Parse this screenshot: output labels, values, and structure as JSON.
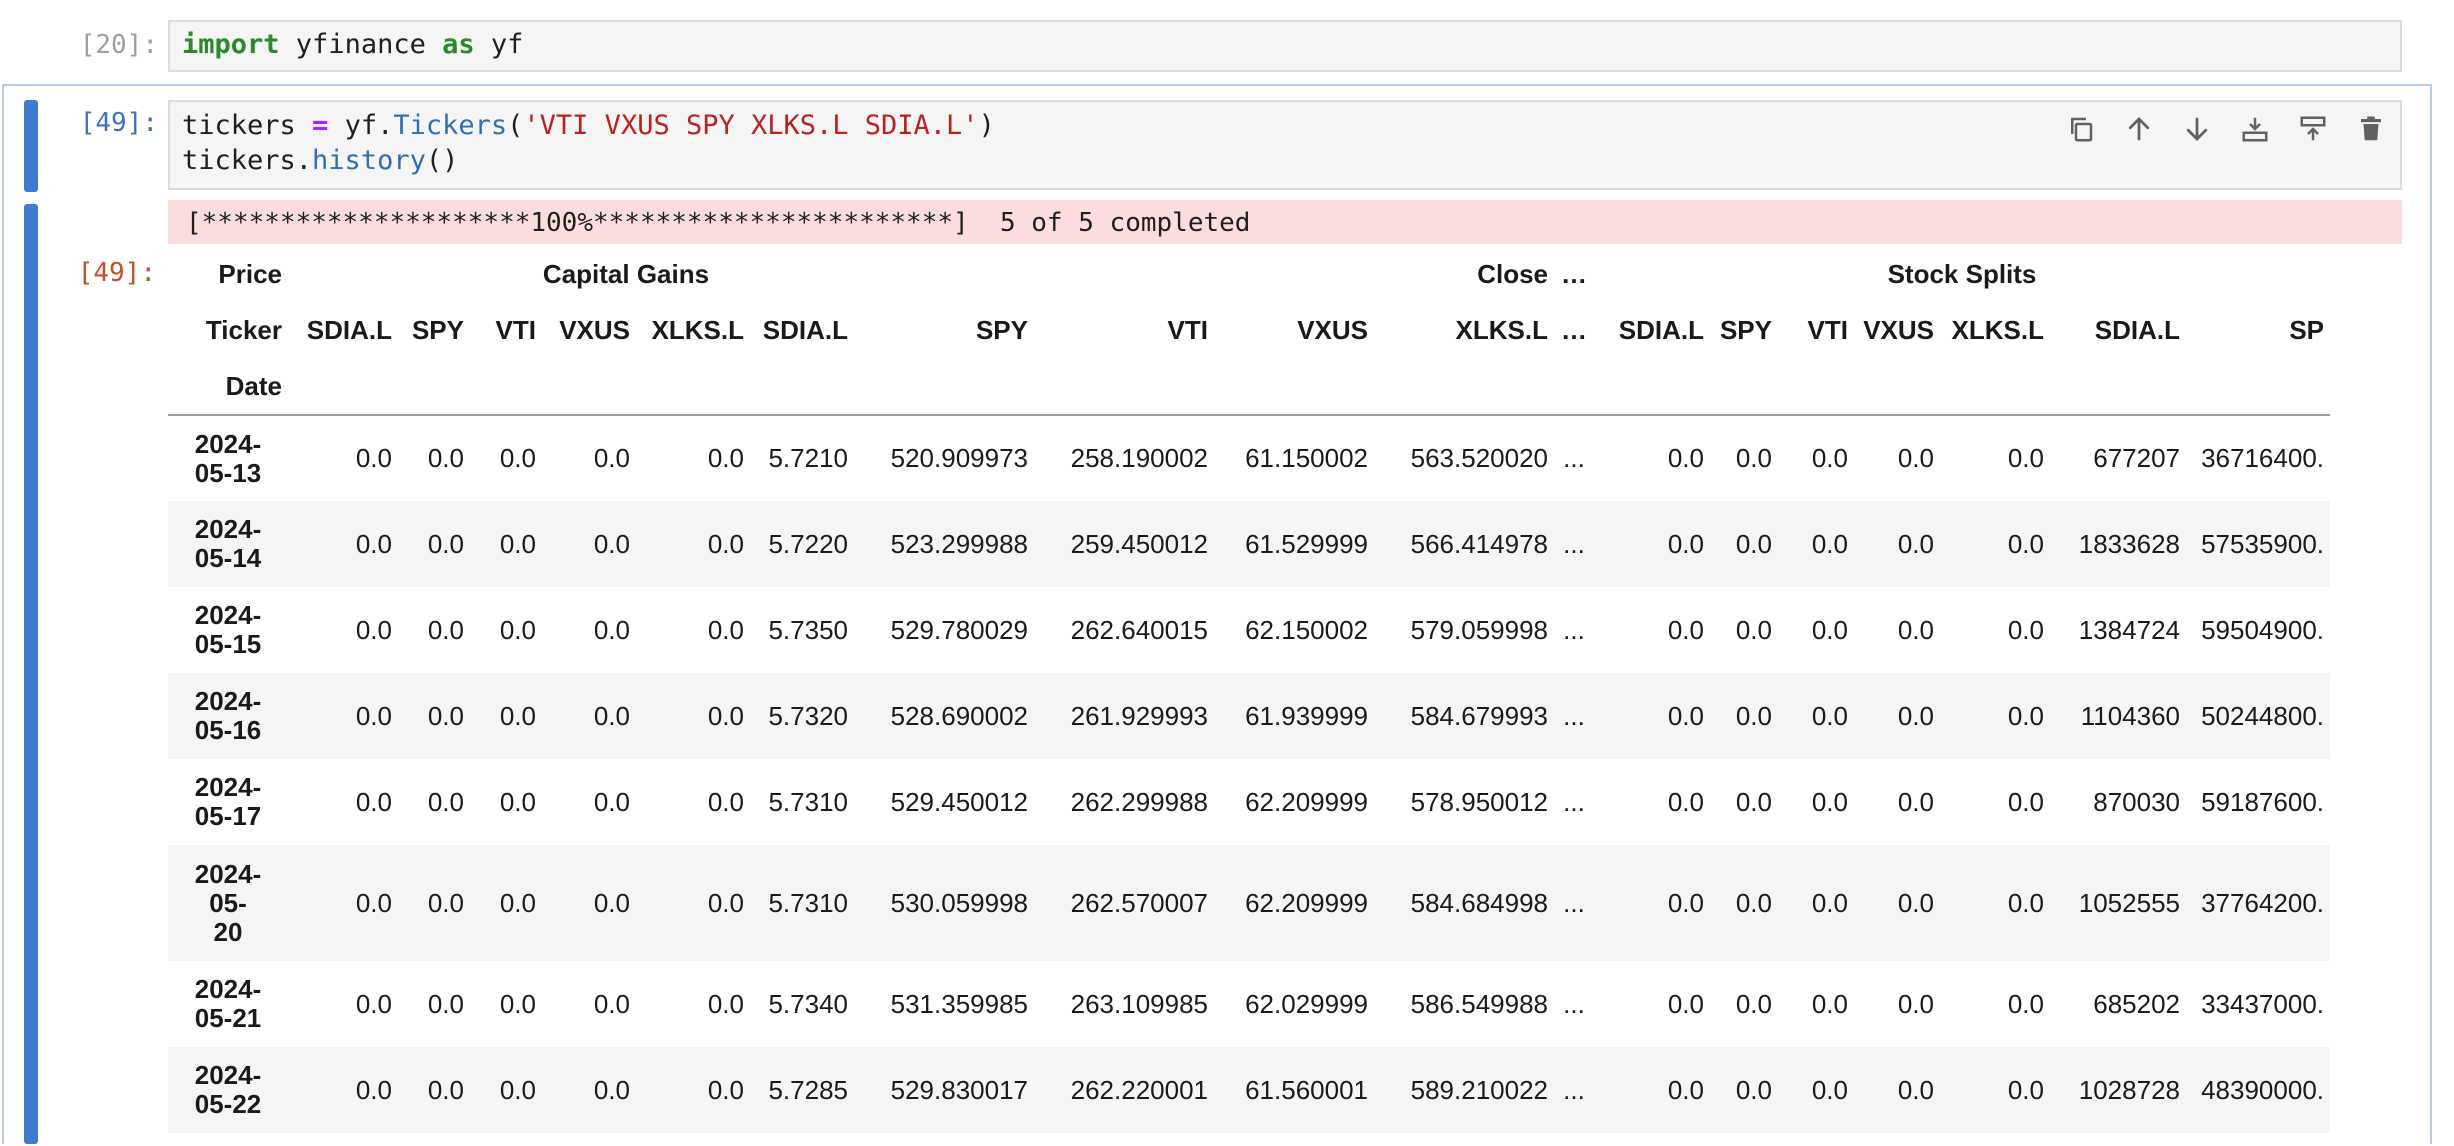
{
  "cell20": {
    "prompt": "[20]:",
    "code": {
      "kw_import": "import",
      "mod": " yfinance ",
      "kw_as": "as",
      "alias": " yf"
    }
  },
  "cell49": {
    "prompt_in": "[49]:",
    "prompt_out": "[49]:",
    "code": {
      "l1_a": "tickers ",
      "l1_eq": "=",
      "l1_b": " yf.",
      "l1_fn": "Tickers",
      "l1_c": "(",
      "l1_str": "'VTI VXUS SPY XLKS.L SDIA.L'",
      "l1_d": ")",
      "l2_a": "tickers.",
      "l2_fn": "history",
      "l2_b": "()"
    },
    "toolbar": [
      "copy-icon",
      "move-up-icon",
      "move-down-icon",
      "insert-below-icon",
      "insert-above-icon",
      "delete-icon"
    ],
    "progress": "[*********************100%***********************]  5 of 5 completed"
  },
  "df": {
    "header_price": [
      "Price",
      "",
      "Capital Gains",
      "",
      "",
      "",
      "Close",
      "",
      "",
      "",
      "…",
      "",
      "Stock Splits",
      "",
      "",
      "",
      "",
      ""
    ],
    "header_ticker": [
      "Ticker",
      "SDIA.L",
      "SPY",
      "VTI",
      "VXUS",
      "XLKS.L",
      "SDIA.L",
      "SPY",
      "VTI",
      "VXUS",
      "XLKS.L",
      "…",
      "SDIA.L",
      "SPY",
      "VTI",
      "VXUS",
      "XLKS.L",
      "SDIA.L",
      "SP"
    ],
    "header_date": "Date",
    "rows": [
      {
        "date": [
          "2024-",
          "05-13"
        ],
        "cells": [
          "0.0",
          "0.0",
          "0.0",
          "0.0",
          "0.0",
          "5.7210",
          "520.909973",
          "258.190002",
          "61.150002",
          "563.520020",
          "...",
          "0.0",
          "0.0",
          "0.0",
          "0.0",
          "0.0",
          "677207",
          "36716400."
        ]
      },
      {
        "date": [
          "2024-",
          "05-14"
        ],
        "cells": [
          "0.0",
          "0.0",
          "0.0",
          "0.0",
          "0.0",
          "5.7220",
          "523.299988",
          "259.450012",
          "61.529999",
          "566.414978",
          "...",
          "0.0",
          "0.0",
          "0.0",
          "0.0",
          "0.0",
          "1833628",
          "57535900."
        ]
      },
      {
        "date": [
          "2024-",
          "05-15"
        ],
        "cells": [
          "0.0",
          "0.0",
          "0.0",
          "0.0",
          "0.0",
          "5.7350",
          "529.780029",
          "262.640015",
          "62.150002",
          "579.059998",
          "...",
          "0.0",
          "0.0",
          "0.0",
          "0.0",
          "0.0",
          "1384724",
          "59504900."
        ]
      },
      {
        "date": [
          "2024-",
          "05-16"
        ],
        "cells": [
          "0.0",
          "0.0",
          "0.0",
          "0.0",
          "0.0",
          "5.7320",
          "528.690002",
          "261.929993",
          "61.939999",
          "584.679993",
          "...",
          "0.0",
          "0.0",
          "0.0",
          "0.0",
          "0.0",
          "1104360",
          "50244800."
        ]
      },
      {
        "date": [
          "2024-",
          "05-17"
        ],
        "cells": [
          "0.0",
          "0.0",
          "0.0",
          "0.0",
          "0.0",
          "5.7310",
          "529.450012",
          "262.299988",
          "62.209999",
          "578.950012",
          "...",
          "0.0",
          "0.0",
          "0.0",
          "0.0",
          "0.0",
          "870030",
          "59187600."
        ]
      },
      {
        "date": [
          "2024-",
          "05-",
          "20"
        ],
        "cells": [
          "0.0",
          "0.0",
          "0.0",
          "0.0",
          "0.0",
          "5.7310",
          "530.059998",
          "262.570007",
          "62.209999",
          "584.684998",
          "...",
          "0.0",
          "0.0",
          "0.0",
          "0.0",
          "0.0",
          "1052555",
          "37764200."
        ]
      },
      {
        "date": [
          "2024-",
          "05-21"
        ],
        "cells": [
          "0.0",
          "0.0",
          "0.0",
          "0.0",
          "0.0",
          "5.7340",
          "531.359985",
          "263.109985",
          "62.029999",
          "586.549988",
          "...",
          "0.0",
          "0.0",
          "0.0",
          "0.0",
          "0.0",
          "685202",
          "33437000."
        ]
      },
      {
        "date": [
          "2024-",
          "05-22"
        ],
        "cells": [
          "0.0",
          "0.0",
          "0.0",
          "0.0",
          "0.0",
          "5.7285",
          "529.830017",
          "262.220001",
          "61.560001",
          "589.210022",
          "...",
          "0.0",
          "0.0",
          "0.0",
          "0.0",
          "0.0",
          "1028728",
          "48390000."
        ]
      }
    ]
  }
}
